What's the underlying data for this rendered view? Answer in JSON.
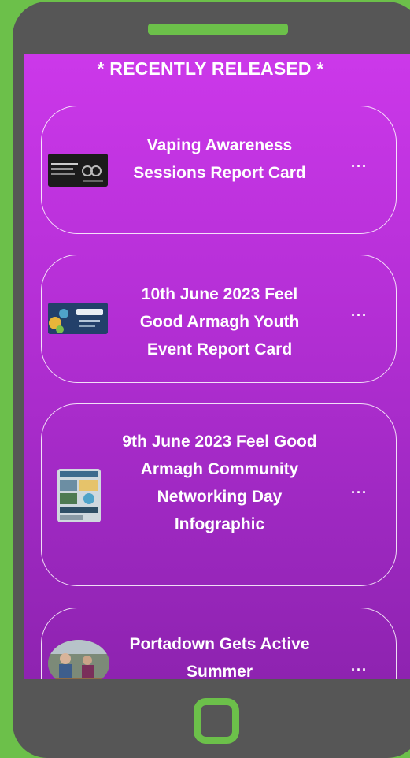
{
  "section": {
    "heading": "* RECENTLY RELEASED *"
  },
  "items": [
    {
      "title": "Vaping Awareness Sessions Report Card",
      "thumbnail": "vaping-report-card-thumbnail",
      "menu": "···"
    },
    {
      "title": "10th June 2023 Feel Good Armagh Youth Event Report Card",
      "thumbnail": "youth-event-report-card-thumbnail",
      "menu": "···"
    },
    {
      "title": "9th June 2023 Feel Good Armagh Community Networking Day Infographic",
      "thumbnail": "infographic-thumbnail",
      "menu": "···"
    },
    {
      "title": "Portadown Gets Active Summer",
      "thumbnail": "portadown-photo-thumbnail",
      "menu": "···"
    }
  ],
  "colors": {
    "frame_green": "#6cc04a",
    "phone_body": "#565656",
    "screen_top": "#cc38ea",
    "screen_bottom": "#8e23b0",
    "text": "#ffffff"
  },
  "icons": {
    "menu": "more-horizontal-icon",
    "home": "home-button-icon"
  }
}
